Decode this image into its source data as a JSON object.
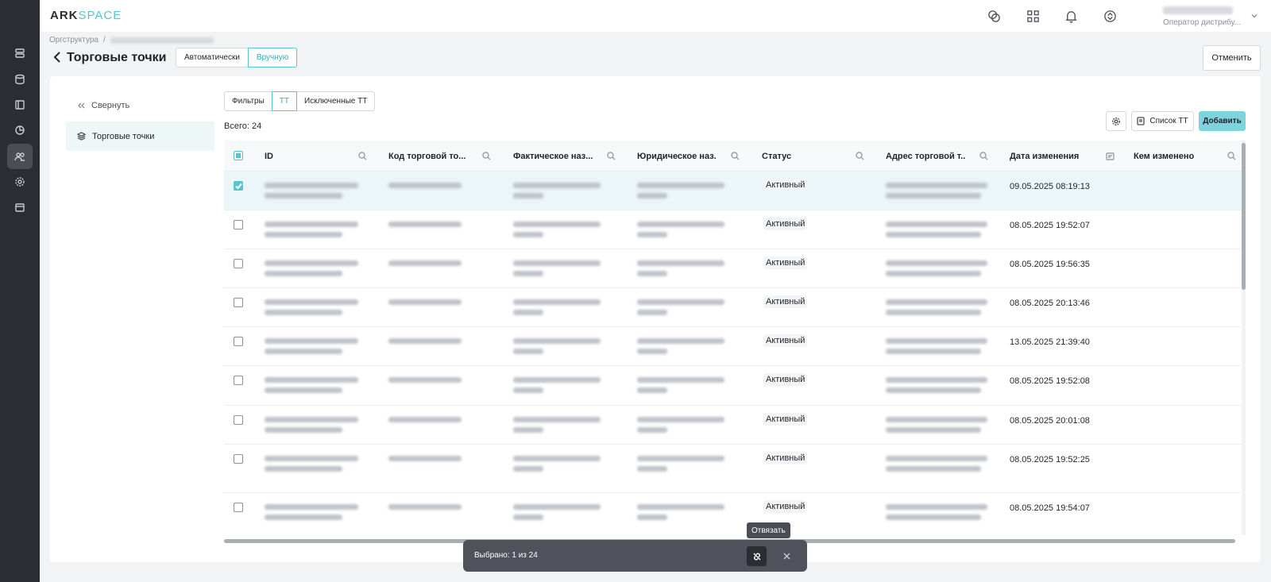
{
  "app": {
    "logo_main": "ARK",
    "logo_accent": "SPACE",
    "user_role": "Оператор дистрибу..."
  },
  "breadcrumb": {
    "root": "Оргструктура",
    "sep": "/"
  },
  "page": {
    "title": "Торговые точки",
    "mode_auto": "Автоматически",
    "mode_manual": "Вручную",
    "cancel": "Отменить"
  },
  "sidebar": {
    "collapse": "Свернуть",
    "item": "Торговые точки"
  },
  "tabs": {
    "filters": "Фильтры",
    "tt": "ТТ",
    "excluded": "Исключенные ТТ"
  },
  "total_label": "Всего: 24",
  "toolbar": {
    "list": "Список ТТ",
    "add": "Добавить"
  },
  "table": {
    "columns": [
      "ID",
      "Код торговой то...",
      "Фактическое наз...",
      "Юридическое наз...",
      "Статус",
      "Адрес торговой т...",
      "Дата изменения",
      "Кем изменено"
    ],
    "rows": [
      {
        "selected": true,
        "status": "Активный",
        "date": "09.05.2025 08:19:13"
      },
      {
        "selected": false,
        "status": "Активный",
        "date": "08.05.2025 19:52:07"
      },
      {
        "selected": false,
        "status": "Активный",
        "date": "08.05.2025 19:56:35"
      },
      {
        "selected": false,
        "status": "Активный",
        "date": "08.05.2025 20:13:46"
      },
      {
        "selected": false,
        "status": "Активный",
        "date": "13.05.2025 21:39:40"
      },
      {
        "selected": false,
        "status": "Активный",
        "date": "08.05.2025 19:52:08"
      },
      {
        "selected": false,
        "status": "Активный",
        "date": "08.05.2025 20:01:08"
      },
      {
        "selected": false,
        "status": "Активный",
        "date": "08.05.2025 19:52:25"
      },
      {
        "selected": false,
        "status": "Активный",
        "date": "08.05.2025 19:54:07"
      }
    ]
  },
  "selection_bar": {
    "text": "Выбрано: 1 из 24",
    "tooltip": "Отвязать"
  }
}
